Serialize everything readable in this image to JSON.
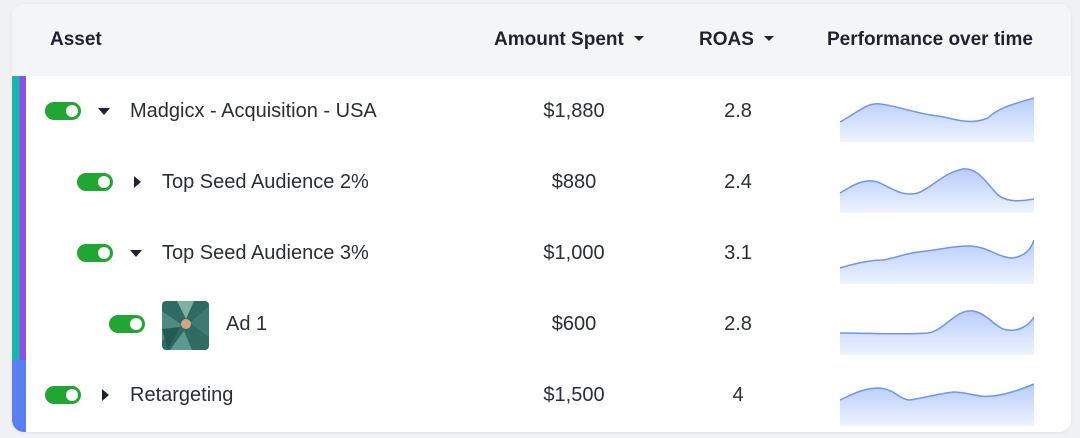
{
  "table": {
    "columns": {
      "asset": "Asset",
      "amount_spent": "Amount Spent",
      "roas": "ROAS",
      "performance": "Performance over time"
    },
    "rows": [
      {
        "name": "Madgicx - Acquisition - USA",
        "amount": "$1,880",
        "roas": "2.8",
        "level": 0,
        "expanded": true
      },
      {
        "name": "Top Seed Audience 2%",
        "amount": "$880",
        "roas": "2.4",
        "level": 1,
        "expanded": false
      },
      {
        "name": "Top Seed Audience 3%",
        "amount": "$1,000",
        "roas": "3.1",
        "level": 1,
        "expanded": true
      },
      {
        "name": "Ad 1",
        "amount": "$600",
        "roas": "2.8",
        "level": 2,
        "has_thumbnail": true
      },
      {
        "name": "Retargeting",
        "amount": "$1,500",
        "roas": "4",
        "level": 0,
        "expanded": false
      }
    ]
  },
  "colors": {
    "toggle_on": "#21a633",
    "accent_teal": "#19b4a9",
    "accent_purple": "#8a52e6",
    "accent_blue": "#5b7ef0",
    "sparkline_stroke": "#6d95f2",
    "sparkline_fill": "#cadbfd"
  },
  "icons": {
    "toggle": "toggle-switch-icon",
    "expand": "caret-down-icon",
    "collapse": "caret-right-icon",
    "sort": "sort-caret-icon"
  }
}
